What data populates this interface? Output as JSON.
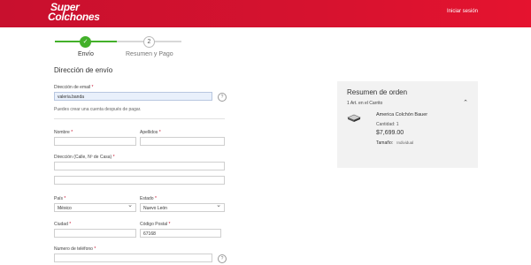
{
  "header": {
    "logo_line1": "Super",
    "logo_line2": "Colchones",
    "login_label": "Iniciar sesión"
  },
  "stepper": {
    "step1_label": "Envío",
    "step2_number": "2",
    "step2_label": "Resumen y Pago"
  },
  "form": {
    "title": "Dirección de envío",
    "email_label": "Dirección de email",
    "email_value": "valeria.banda",
    "email_hint": "Puedes crear una cuenta después de pagar.",
    "first_name_label": "Nombre",
    "last_name_label": "Apellidos",
    "address_label": "Dirección (Calle, Nº de Casa)",
    "country_label": "País",
    "country_value": "México",
    "state_label": "Estado",
    "state_value": "Nuevo León",
    "city_label": "Ciudad",
    "zip_label": "Código Postal",
    "zip_value": "67168",
    "phone_label": "Numero de teléfono",
    "required_mark": "*",
    "help_glyph": "?"
  },
  "summary": {
    "title": "Resumen de orden",
    "count": "1 Art. en el Carrito",
    "product_name": "America Colchón Bauer",
    "quantity": "Cantidad: 1",
    "price": "$7,699.00",
    "size_label": "Tamaño:",
    "size_value": "Individual"
  },
  "colors": {
    "brand_red": "#c8102e",
    "step_green": "#43b02a"
  }
}
